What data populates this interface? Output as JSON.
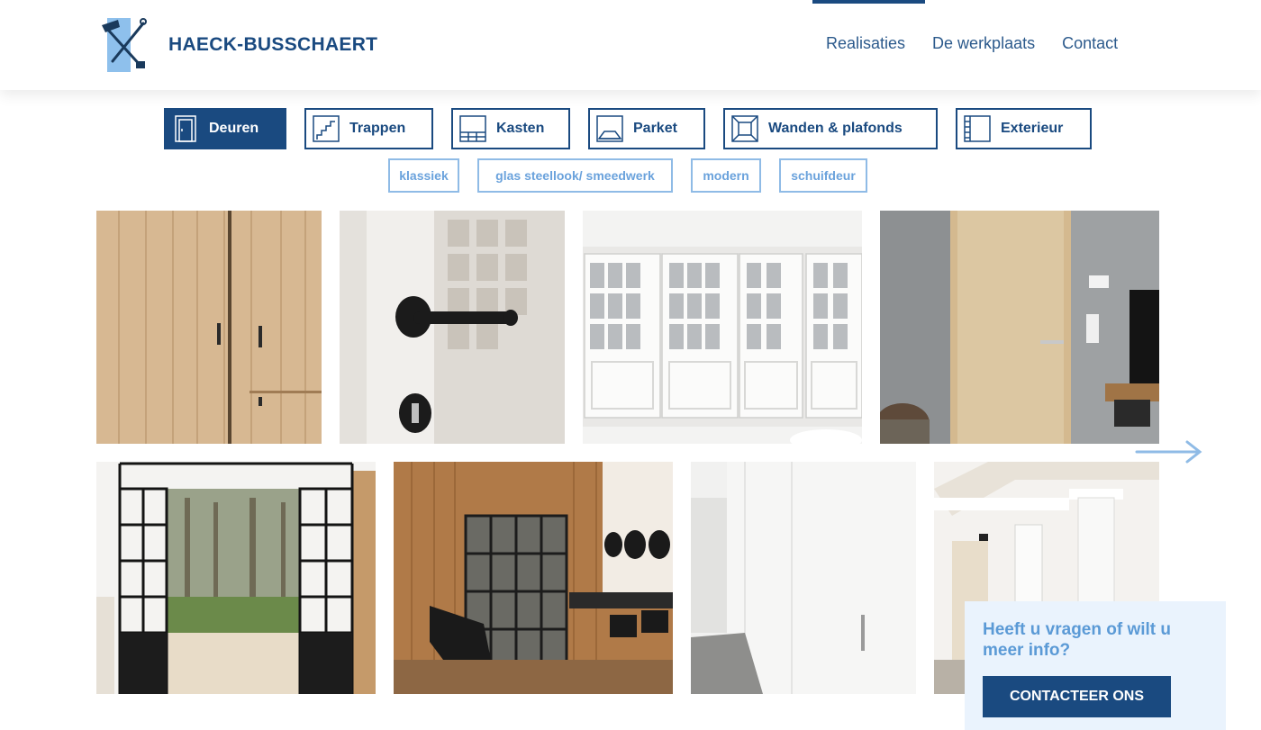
{
  "brand": {
    "name": "HAECK-BUSSCHAERT",
    "logo_icon": "hammer-and-tools-icon"
  },
  "nav": {
    "items": [
      "Realisaties",
      "De werkplaats",
      "Contact"
    ],
    "active": "Realisaties"
  },
  "categories": [
    {
      "label": "Deuren",
      "icon": "door-icon",
      "active": true
    },
    {
      "label": "Trappen",
      "icon": "stairs-icon",
      "active": false
    },
    {
      "label": "Kasten",
      "icon": "cabinet-icon",
      "active": false
    },
    {
      "label": "Parket",
      "icon": "parquet-icon",
      "active": false
    },
    {
      "label": "Wanden & plafonds",
      "icon": "wall-panel-icon",
      "active": false
    },
    {
      "label": "Exterieur",
      "icon": "exterior-icon",
      "active": false
    }
  ],
  "subfilters": [
    "klassiek",
    "glas steellook/ smeedwerk",
    "modern",
    "schuifdeur"
  ],
  "gallery": {
    "next_icon": "arrow-right-icon"
  },
  "contact": {
    "question": "Heeft u vragen of wilt u meer info?",
    "button_label": "CONTACTEER ONS"
  },
  "colors": {
    "primary": "#1a4a80",
    "light_accent": "#6aa2dc",
    "contact_bg": "#eaf3fd"
  }
}
